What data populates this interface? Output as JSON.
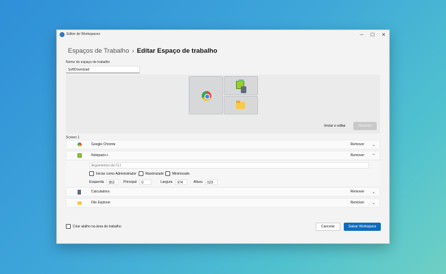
{
  "window": {
    "title": "Editor de Workspaces",
    "controls": {
      "minimize": "─",
      "maximize": "☐",
      "close": "✕"
    }
  },
  "breadcrumb": {
    "parent": "Espaços de Trabalho",
    "separator": "›",
    "current": "Editar Espaço de trabalho"
  },
  "workspace_name": {
    "label": "Nome do espaço de trabalho",
    "value": "SoftDownload"
  },
  "actions": {
    "launch_edit": "Iniciar e editar",
    "revert": "Reverter"
  },
  "screen": {
    "label": "Screen 1"
  },
  "apps": [
    {
      "name": "Google Chrome",
      "remove": "Remover",
      "expanded": false,
      "icon": "chrome-icon"
    },
    {
      "name": "Notepad++",
      "remove": "Remover",
      "expanded": true,
      "icon": "notepadpp-icon"
    },
    {
      "name": "Calculadora",
      "remove": "Remover",
      "expanded": false,
      "icon": "calculator-icon"
    },
    {
      "name": "File Explorer",
      "remove": "Remover",
      "expanded": false,
      "icon": "folder-icon"
    }
  ],
  "notepad_details": {
    "args_placeholder": "Argumentos da CLI",
    "options": {
      "admin": "Iniciar como Administrador",
      "maximized": "Maximizado",
      "minimized": "Minimizado"
    },
    "position": {
      "left_label": "Esquerda",
      "left": "953",
      "top_label": "Principal",
      "top": "0",
      "width_label": "Largura",
      "width": "974",
      "height_label": "Altura",
      "height": "523"
    }
  },
  "footer": {
    "shortcut_label": "Criar atalho na área de trabalho",
    "cancel": "Cancelar",
    "save": "Salvar Workspace"
  },
  "colors": {
    "accent": "#0f6cbd",
    "background": "#f3f3f3"
  }
}
